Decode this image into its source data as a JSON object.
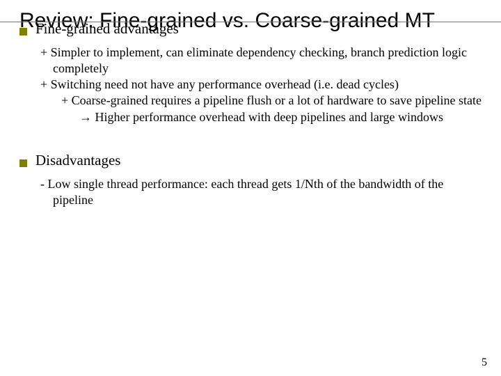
{
  "slide": {
    "title": "Review: Fine-grained vs. Coarse-grained MT",
    "bullets": [
      {
        "label": "Fine-grained advantages",
        "subs": [
          "+ Simpler to implement, can eliminate dependency checking, branch prediction logic completely",
          "+ Switching need not have any performance overhead (i.e. dead cycles)"
        ],
        "subsubs": [
          "+ Coarse-grained requires a pipeline flush or a lot of hardware to save pipeline state",
          "→ Higher performance overhead with deep pipelines and large windows"
        ]
      },
      {
        "label": "Disadvantages",
        "subs": [
          "- Low single thread performance: each thread gets 1/Nth of the bandwidth of the pipeline"
        ]
      }
    ],
    "page_number": "5"
  }
}
